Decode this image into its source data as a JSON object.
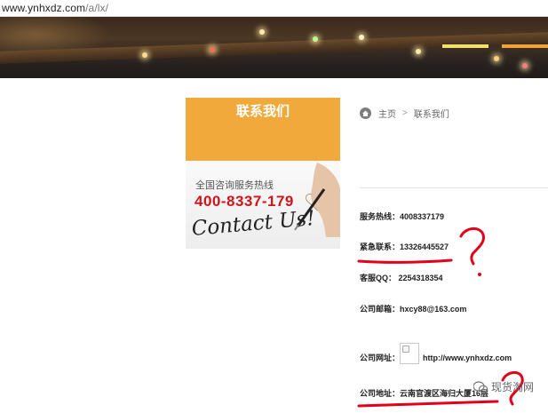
{
  "browser": {
    "url_host": "www.ynhxdz.com",
    "url_path": "/a/lx/"
  },
  "sidebar": {
    "title": "联系我们",
    "card": {
      "hotline_label": "全国咨询服务热线",
      "hotline_number": "400-8337-179",
      "script_text": "Contact Us!"
    }
  },
  "breadcrumb": {
    "home": "主页",
    "separator": ">",
    "current": "联系我们"
  },
  "contact": {
    "service_hotline": "服务热线：4008337179",
    "emergency": "紧急联系：13326445527",
    "qq": "客服QQ： 2254318354",
    "email": "公司邮箱：hxcy88@163.com",
    "website_label": "公司网址：",
    "website_url": "http://www.ynhxdz.com",
    "address": "公司地址：云南官渡区海归大厦16层"
  },
  "watermark": "现货淘网",
  "colors": {
    "accent_orange": "#f2a93b",
    "hotline_red": "#d0141a",
    "annotation_red": "#e2001a"
  }
}
